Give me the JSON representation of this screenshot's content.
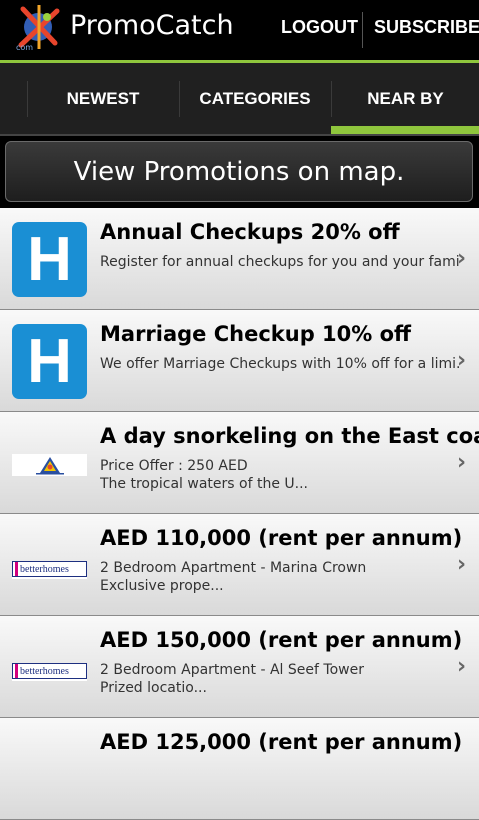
{
  "app": {
    "title": "PromoCatch",
    "logo_text": "com"
  },
  "header": {
    "logout_label": "LOGOUT",
    "subscribe_label": "SUBSCRIBE"
  },
  "tabs": [
    {
      "label": "NEWEST",
      "active": false
    },
    {
      "label": "CATEGORIES",
      "active": false
    },
    {
      "label": "NEAR BY",
      "active": true
    }
  ],
  "colors": {
    "accent": "#8fc63d",
    "hospital_tile": "#1a8fd4",
    "betterhomes_blue": "#1d2f80",
    "betterhomes_pink": "#d2007d"
  },
  "map_button": {
    "label": "View Promotions on map."
  },
  "promotions": [
    {
      "icon": "hospital-icon",
      "title": "Annual Checkups 20% off",
      "line1": "Register for annual checkups for you and your fami...",
      "line2": ""
    },
    {
      "icon": "hospital-icon",
      "title": "Marriage Checkup 10% off",
      "line1": "We offer Marriage Checkups with 10% off for a limi...",
      "line2": ""
    },
    {
      "icon": "snorkel-logo",
      "title": "A day snorkeling on the East coast",
      "line1": "Price Offer : 250 AED",
      "line2": "The tropical waters of the U..."
    },
    {
      "icon": "betterhomes-logo",
      "logo_text": "betterhomes",
      "title": "AED 110,000 (rent per annum)",
      "line1": "2 Bedroom Apartment - Marina Crown",
      "line2": "Exclusive prope..."
    },
    {
      "icon": "betterhomes-logo",
      "logo_text": "betterhomes",
      "title": "AED 150,000 (rent per annum)",
      "line1": "2 Bedroom Apartment - Al Seef Tower",
      "line2": "Prized locatio..."
    },
    {
      "icon": "",
      "title": "AED 125,000 (rent per annum)",
      "line1": "",
      "line2": ""
    }
  ],
  "hospital_letter": "H"
}
